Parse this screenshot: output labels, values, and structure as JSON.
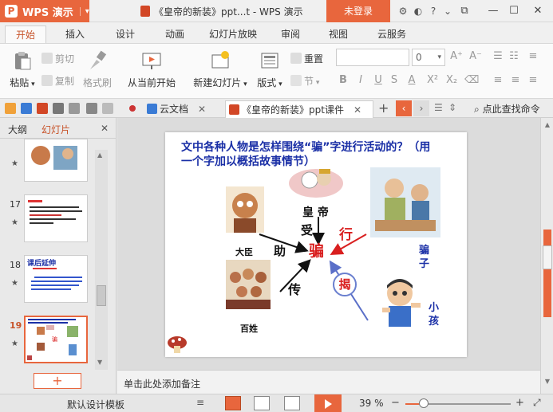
{
  "app": {
    "name": "WPS 演示",
    "logo_letter": "P",
    "caret": "▾"
  },
  "window": {
    "title": "《皇帝的新装》ppt...t - WPS 演示",
    "login_label": "未登录"
  },
  "menu": {
    "tabs": [
      "开始",
      "插入",
      "设计",
      "动画",
      "幻灯片放映",
      "审阅",
      "视图",
      "云服务"
    ],
    "active": "开始"
  },
  "ribbon": {
    "paste": "粘贴",
    "cut": "剪切",
    "copy": "复制",
    "format_painter": "格式刷",
    "from_current": "从当前开始",
    "new_slide": "新建幻灯片",
    "layout": "版式",
    "reset": "重置",
    "section": "节",
    "font_size": "0"
  },
  "doc_tabs": {
    "cloud": "云文档",
    "current": "《皇帝的新装》ppt课件",
    "search_label": "点此查找命令"
  },
  "left_panel": {
    "tab_outline": "大纲",
    "tab_slides": "幻灯片",
    "close": "✕",
    "slides": [
      {
        "num": "",
        "star": "★"
      },
      {
        "num": "17",
        "star": "★"
      },
      {
        "num": "18",
        "star": "★",
        "title": "课后延伸"
      },
      {
        "num": "19",
        "star": "★"
      }
    ],
    "add_label": "+"
  },
  "slide": {
    "question": "文中各种人物是怎样围绕“骗”字进行活动的？（用一个字加以概括故事情节）",
    "center": "骗",
    "labels": {
      "emperor": "皇 帝",
      "shou": "受",
      "xing": "行",
      "zhu": "助",
      "minister": "大臣",
      "chuan": "传",
      "people": "百姓",
      "jie": "揭",
      "pianzi": "骗子",
      "child": "小孩"
    }
  },
  "notes": {
    "placeholder": "单击此处添加备注"
  },
  "status": {
    "template": "默认设计模板",
    "zoom": "39 %",
    "zoom_fraction": 0.39
  },
  "colors": {
    "accent": "#e8663d",
    "question_blue": "#1a2fa6",
    "pian_red": "#d91f1f"
  }
}
